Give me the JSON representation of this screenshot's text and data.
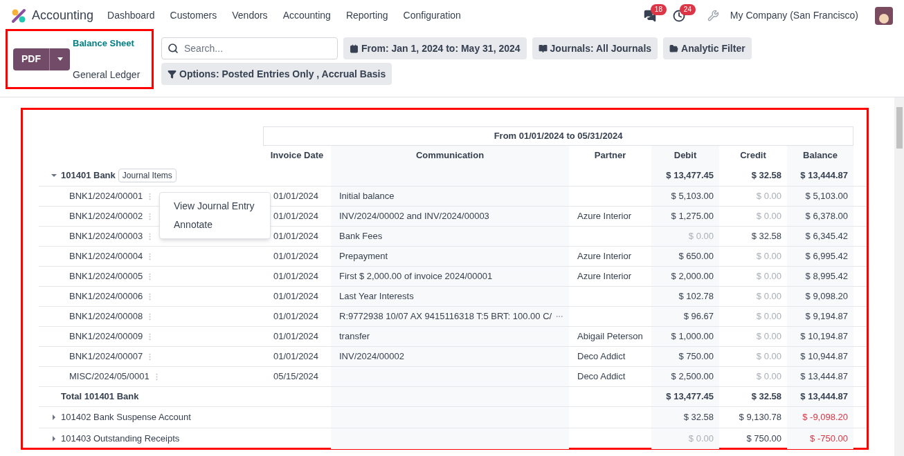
{
  "navbar": {
    "app": "Accounting",
    "menu": [
      "Dashboard",
      "Customers",
      "Vendors",
      "Accounting",
      "Reporting",
      "Configuration"
    ],
    "messages_badge": "18",
    "activities_badge": "24",
    "company": "My Company (San Francisco)"
  },
  "print_area": {
    "highlighted": true,
    "button": "PDF",
    "breadcrumbs": [
      {
        "label": "Balance Sheet",
        "selected": false
      },
      {
        "label": "General Ledger",
        "selected": true
      }
    ]
  },
  "search": {
    "placeholder": "Search..."
  },
  "filters": [
    {
      "kind": "calendar",
      "label": "From: Jan 1, 2024 to: May 31, 2024"
    },
    {
      "kind": "book",
      "label": "Journals: All Journals"
    },
    {
      "kind": "folder",
      "label": "Analytic Filter"
    },
    {
      "kind": "filter",
      "label": "Options: Posted Entries Only , Accrual Basis"
    }
  ],
  "report": {
    "highlighted": true,
    "period": "From 01/01/2024 to 05/31/2024",
    "columns": [
      "Invoice Date",
      "Communication",
      "Partner",
      "Debit",
      "Credit",
      "Balance"
    ],
    "rows": [
      {
        "kind": "group",
        "expanded": true,
        "name": "101401 Bank",
        "badge": "Journal Items",
        "debit": {
          "value": "$ 13,477.45",
          "kind": "normal"
        },
        "credit": {
          "value": "$ 32.58",
          "kind": "normal"
        },
        "balance": {
          "value": "$ 13,444.87",
          "kind": "normal"
        }
      },
      {
        "kind": "line",
        "name": "BNK1/2024/00001",
        "date": "01/01/2024",
        "communication": "Initial balance",
        "debit": {
          "value": "$ 5,103.00",
          "kind": "normal"
        },
        "credit": {
          "value": "$ 0.00",
          "kind": "zero"
        },
        "balance": {
          "value": "$ 5,103.00",
          "kind": "normal"
        }
      },
      {
        "kind": "line",
        "name": "BNK1/2024/00002",
        "date": "01/01/2024",
        "communication": "INV/2024/00002 and INV/2024/00003",
        "partner": "Azure Interior",
        "debit": {
          "value": "$ 1,275.00",
          "kind": "normal"
        },
        "credit": {
          "value": "$ 0.00",
          "kind": "zero"
        },
        "balance": {
          "value": "$ 6,378.00",
          "kind": "normal"
        }
      },
      {
        "kind": "line",
        "name": "BNK1/2024/00003",
        "date": "01/01/2024",
        "communication": "Bank Fees",
        "debit": {
          "value": "$ 0.00",
          "kind": "zero"
        },
        "credit": {
          "value": "$ 32.58",
          "kind": "normal"
        },
        "balance": {
          "value": "$ 6,345.42",
          "kind": "normal"
        }
      },
      {
        "kind": "line",
        "name": "BNK1/2024/00004",
        "date": "01/01/2024",
        "communication": "Prepayment",
        "partner": "Azure Interior",
        "debit": {
          "value": "$ 650.00",
          "kind": "normal"
        },
        "credit": {
          "value": "$ 0.00",
          "kind": "zero"
        },
        "balance": {
          "value": "$ 6,995.42",
          "kind": "normal"
        }
      },
      {
        "kind": "line",
        "name": "BNK1/2024/00005",
        "date": "01/01/2024",
        "communication": "First $ 2,000.00 of invoice 2024/00001",
        "partner": "Azure Interior",
        "debit": {
          "value": "$ 2,000.00",
          "kind": "normal"
        },
        "credit": {
          "value": "$ 0.00",
          "kind": "zero"
        },
        "balance": {
          "value": "$ 8,995.42",
          "kind": "normal"
        }
      },
      {
        "kind": "line",
        "name": "BNK1/2024/00006",
        "date": "01/01/2024",
        "communication": "Last Year Interests",
        "debit": {
          "value": "$ 102.78",
          "kind": "normal"
        },
        "credit": {
          "value": "$ 0.00",
          "kind": "zero"
        },
        "balance": {
          "value": "$ 9,098.20",
          "kind": "normal"
        }
      },
      {
        "kind": "line",
        "name": "BNK1/2024/00008",
        "date": "01/01/2024",
        "communication": "R:9772938 10/07 AX 9415116318 T:5 BRT: 100.00 C/",
        "truncated": true,
        "debit": {
          "value": "$ 96.67",
          "kind": "normal"
        },
        "credit": {
          "value": "$ 0.00",
          "kind": "zero"
        },
        "balance": {
          "value": "$ 9,194.87",
          "kind": "normal"
        }
      },
      {
        "kind": "line",
        "name": "BNK1/2024/00009",
        "date": "01/01/2024",
        "communication": "transfer",
        "partner": "Abigail Peterson",
        "debit": {
          "value": "$ 1,000.00",
          "kind": "normal"
        },
        "credit": {
          "value": "$ 0.00",
          "kind": "zero"
        },
        "balance": {
          "value": "$ 10,194.87",
          "kind": "normal"
        }
      },
      {
        "kind": "line",
        "name": "BNK1/2024/00007",
        "date": "01/01/2024",
        "communication": "INV/2024/00002",
        "partner": "Deco Addict",
        "debit": {
          "value": "$ 750.00",
          "kind": "normal"
        },
        "credit": {
          "value": "$ 0.00",
          "kind": "zero"
        },
        "balance": {
          "value": "$ 10,944.87",
          "kind": "normal"
        }
      },
      {
        "kind": "line",
        "name": "MISC/2024/05/0001",
        "date": "05/15/2024",
        "partner": "Deco Addict",
        "debit": {
          "value": "$ 2,500.00",
          "kind": "normal"
        },
        "credit": {
          "value": "$ 0.00",
          "kind": "zero"
        },
        "balance": {
          "value": "$ 13,444.87",
          "kind": "normal"
        }
      },
      {
        "kind": "total",
        "name": "Total 101401 Bank",
        "debit": {
          "value": "$ 13,477.45",
          "kind": "normal"
        },
        "credit": {
          "value": "$ 32.58",
          "kind": "normal"
        },
        "balance": {
          "value": "$ 13,444.87",
          "kind": "normal"
        }
      },
      {
        "kind": "group",
        "expanded": false,
        "name": "101402 Bank Suspense Account",
        "debit": {
          "value": "$ 32.58",
          "kind": "normal"
        },
        "credit": {
          "value": "$ 9,130.78",
          "kind": "normal"
        },
        "balance": {
          "value": "$ -9,098.20",
          "kind": "negative"
        }
      },
      {
        "kind": "group",
        "expanded": false,
        "name": "101403 Outstanding Receipts",
        "debit": {
          "value": "$ 0.00",
          "kind": "zero"
        },
        "credit": {
          "value": "$ 750.00",
          "kind": "normal"
        },
        "balance": {
          "value": "$ -750.00",
          "kind": "negative"
        }
      }
    ],
    "context_menu": [
      "View Journal Entry",
      "Annotate"
    ]
  }
}
